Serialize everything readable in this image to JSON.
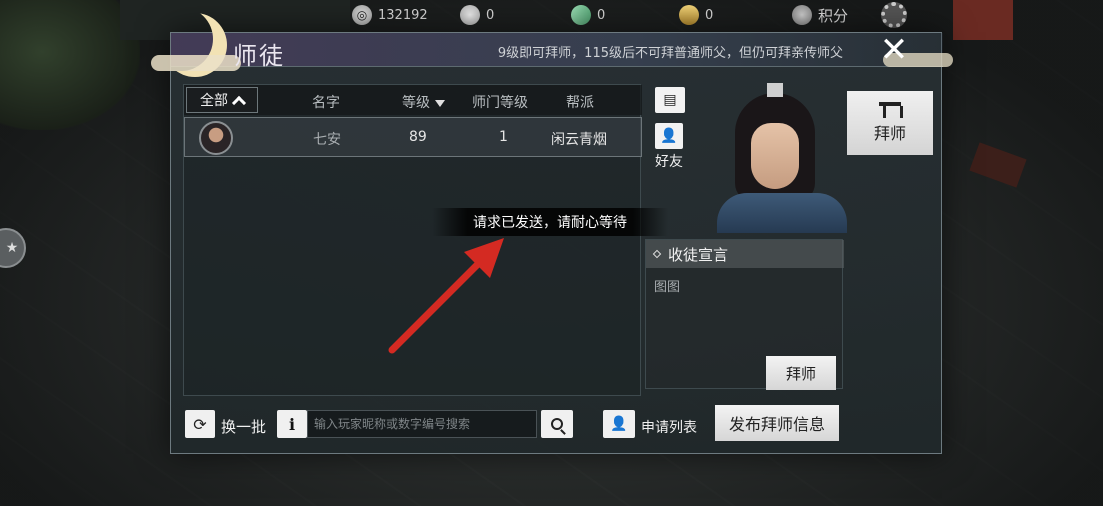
{
  "resources": {
    "coin": "132192",
    "silver": "0",
    "jade": "0",
    "gold": "0",
    "score_label": "积分"
  },
  "panel": {
    "title": "师徒",
    "hint": "9级即可拜师，115级后不可拜普通师父，但仍可拜亲传师父",
    "close_symbol": "✕"
  },
  "list": {
    "filter_label": "全部",
    "columns": {
      "name": "名字",
      "level": "等级",
      "sect_level": "师门等级",
      "faction": "帮派"
    },
    "rows": [
      {
        "name": "七安",
        "level": "89",
        "sect_level": "1",
        "faction": "闲云青烟"
      }
    ]
  },
  "side": {
    "chat_icon": "chat-bubble-icon",
    "friend_label": "好友",
    "tab_label": "拜师"
  },
  "declaration": {
    "title": "收徒宣言",
    "text": "图图",
    "button_label": "拜师"
  },
  "toast": {
    "message": "请求已发送，请耐心等待"
  },
  "bottom": {
    "refresh_label": "换一批",
    "info_symbol": "i",
    "search_placeholder": "输入玩家昵称或数字编号搜索",
    "apply_list_label": "申请列表",
    "publish_label": "发布拜师信息"
  },
  "colors": {
    "annotation_arrow": "#d42a22",
    "panel_bg": "#283034",
    "button_bg": "#f0f0f0"
  }
}
